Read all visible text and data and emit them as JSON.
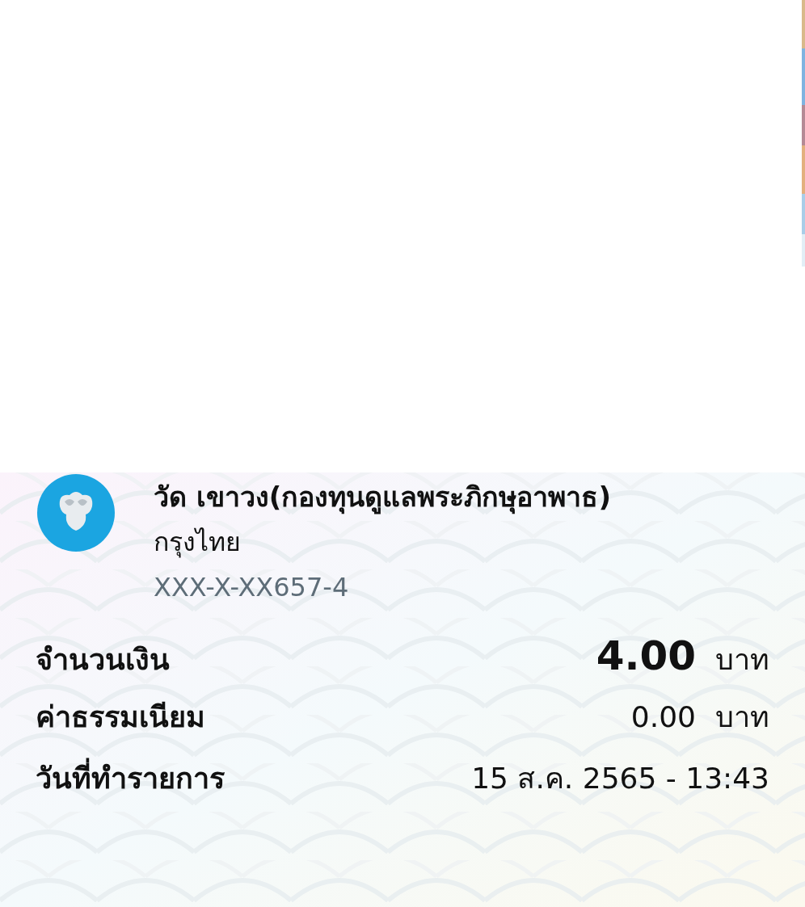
{
  "recipient": {
    "name": "วัด เขาวง(กองทุนดูแลพระภิกษุอาพาธ)",
    "bank": "กรุงไทย",
    "account": "XXX-X-XX657-4"
  },
  "details": [
    {
      "kind": "amount",
      "label": "จำนวนเงิน",
      "value": "4.00",
      "unit": "บาท"
    },
    {
      "kind": "plain",
      "label": "ค่าธรรมเนียม",
      "value": "0.00",
      "unit": "บาท"
    },
    {
      "kind": "plain",
      "label": "วันที่ทำรายการ",
      "value": "15 ส.ค. 2565 - 13:43"
    }
  ]
}
